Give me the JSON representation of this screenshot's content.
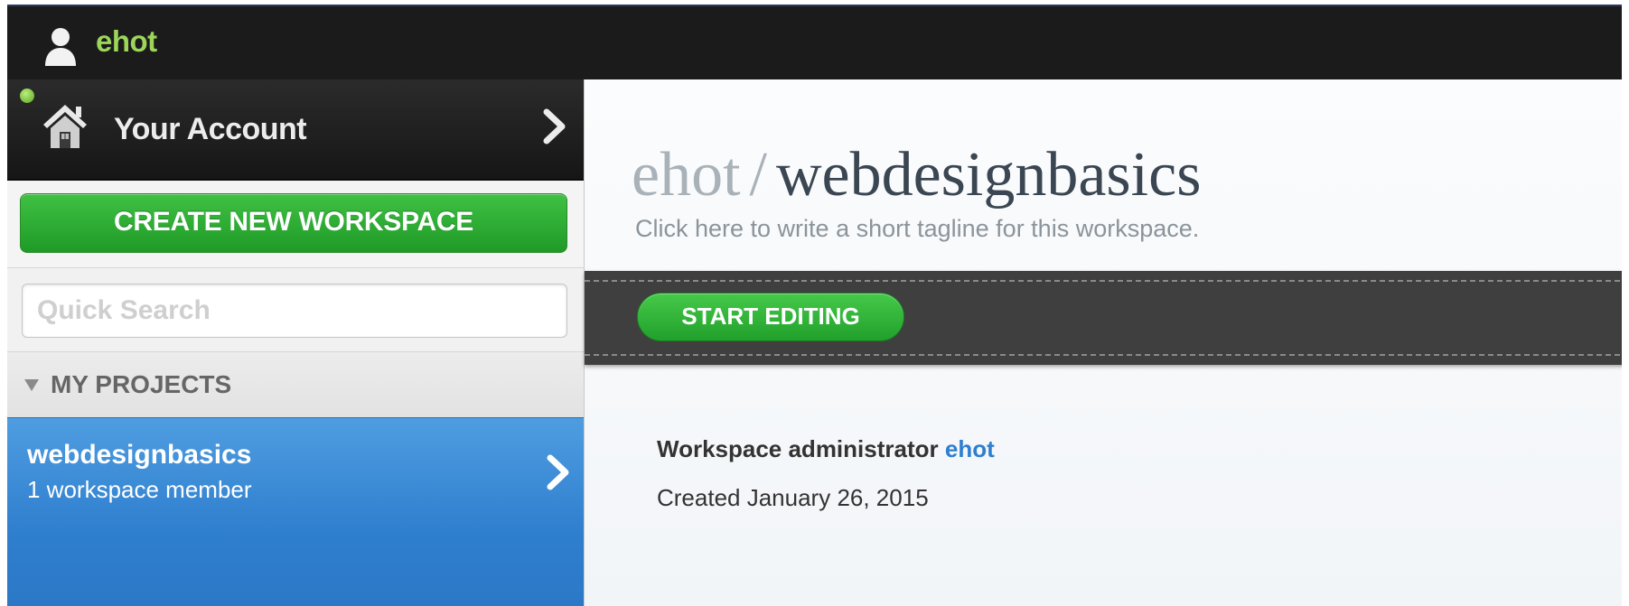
{
  "header": {
    "username": "ehot"
  },
  "sidebar": {
    "account_label": "Your Account",
    "create_workspace_label": "CREATE NEW WORKSPACE",
    "search_placeholder": "Quick Search",
    "projects_heading": "MY PROJECTS",
    "projects": [
      {
        "name": "webdesignbasics",
        "meta": "1 workspace member"
      }
    ]
  },
  "main": {
    "title_owner": "ehot",
    "title_separator": "/",
    "title_workspace": "webdesignbasics",
    "tagline": "Click here to write a short tagline for this workspace.",
    "start_editing_label": "START EDITING",
    "admin_label": "Workspace administrator",
    "admin_name": "ehot",
    "created_text": "Created January 26, 2015"
  },
  "colors": {
    "topbar": "#1b1b1b",
    "username": "#9bd55a",
    "green_button": "#2aa832",
    "selected_project": "#3a8ad8",
    "link": "#2f7fcf"
  },
  "icons": {
    "user": "user-icon",
    "home": "home-icon",
    "chevron": "chevron-right-icon",
    "collapse": "triangle-down-icon",
    "status": "online-status-dot"
  }
}
